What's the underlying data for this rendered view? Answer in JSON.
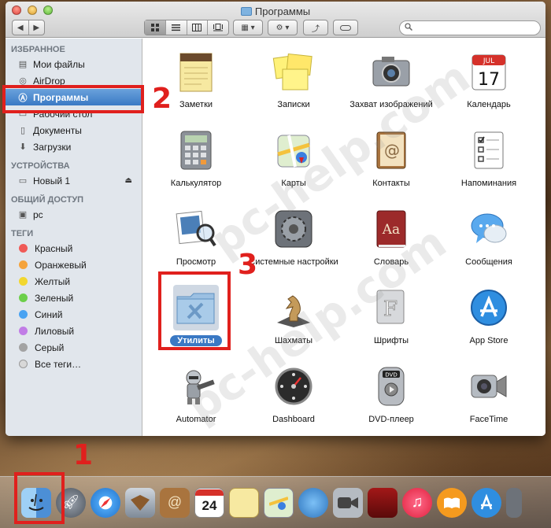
{
  "window": {
    "title": "Программы"
  },
  "toolbar": {
    "search_placeholder": ""
  },
  "sidebar": {
    "favorites_title": "ИЗБРАННОЕ",
    "favorites": [
      {
        "label": "Мои файлы",
        "icon": "all-files-icon"
      },
      {
        "label": "AirDrop",
        "icon": "airdrop-icon"
      },
      {
        "label": "Программы",
        "icon": "applications-icon"
      },
      {
        "label": "Рабочий стол",
        "icon": "desktop-icon"
      },
      {
        "label": "Документы",
        "icon": "documents-icon"
      },
      {
        "label": "Загрузки",
        "icon": "downloads-icon"
      }
    ],
    "devices_title": "УСТРОЙСТВА",
    "devices": [
      {
        "label": "Новый 1",
        "icon": "disk-icon"
      }
    ],
    "shared_title": "ОБЩИЙ ДОСТУП",
    "shared": [
      {
        "label": "pc",
        "icon": "computer-icon"
      }
    ],
    "tags_title": "ТЕГИ",
    "tags": [
      {
        "label": "Красный",
        "color": "#f05a57"
      },
      {
        "label": "Оранжевый",
        "color": "#f5a33b"
      },
      {
        "label": "Желтый",
        "color": "#f2d72f"
      },
      {
        "label": "Зеленый",
        "color": "#6ccf4a"
      },
      {
        "label": "Синий",
        "color": "#4aa3f2"
      },
      {
        "label": "Лиловый",
        "color": "#c17de6"
      },
      {
        "label": "Серый",
        "color": "#a3a3a3"
      },
      {
        "label": "Все теги…",
        "color": ""
      }
    ]
  },
  "apps": [
    {
      "label": "Заметки",
      "icon": "notes-icon"
    },
    {
      "label": "Записки",
      "icon": "stickies-icon"
    },
    {
      "label": "Захват изображений",
      "icon": "image-capture-icon"
    },
    {
      "label": "Календарь",
      "icon": "calendar-icon",
      "day": "17",
      "month": "JUL"
    },
    {
      "label": "Калькулятор",
      "icon": "calculator-icon"
    },
    {
      "label": "Карты",
      "icon": "maps-icon"
    },
    {
      "label": "Контакты",
      "icon": "contacts-icon"
    },
    {
      "label": "Напоминания",
      "icon": "reminders-icon"
    },
    {
      "label": "Просмотр",
      "icon": "preview-icon"
    },
    {
      "label": "Системные настройки",
      "icon": "system-preferences-icon"
    },
    {
      "label": "Словарь",
      "icon": "dictionary-icon",
      "text": "Aa"
    },
    {
      "label": "Сообщения",
      "icon": "messages-icon"
    },
    {
      "label": "Утилиты",
      "icon": "utilities-folder-icon"
    },
    {
      "label": "Шахматы",
      "icon": "chess-icon"
    },
    {
      "label": "Шрифты",
      "icon": "font-book-icon",
      "text": "F"
    },
    {
      "label": "App Store",
      "icon": "app-store-icon"
    },
    {
      "label": "Automator",
      "icon": "automator-icon"
    },
    {
      "label": "Dashboard",
      "icon": "dashboard-icon"
    },
    {
      "label": "DVD-плеер",
      "icon": "dvd-player-icon",
      "text": "DVD"
    },
    {
      "label": "FaceTime",
      "icon": "facetime-icon"
    }
  ],
  "annotations": {
    "n1": "1",
    "n2": "2",
    "n3": "3"
  },
  "watermark": "pc-help.com",
  "dock": {
    "calendar_day": "24",
    "items": [
      "finder-icon",
      "launchpad-icon",
      "safari-icon",
      "mail-icon",
      "contacts-icon",
      "calendar-icon",
      "notes-icon",
      "maps-icon",
      "messages-icon",
      "facetime-icon",
      "photo-booth-icon",
      "itunes-icon",
      "ibooks-icon",
      "app-store-icon",
      "system-preferences-icon"
    ]
  }
}
